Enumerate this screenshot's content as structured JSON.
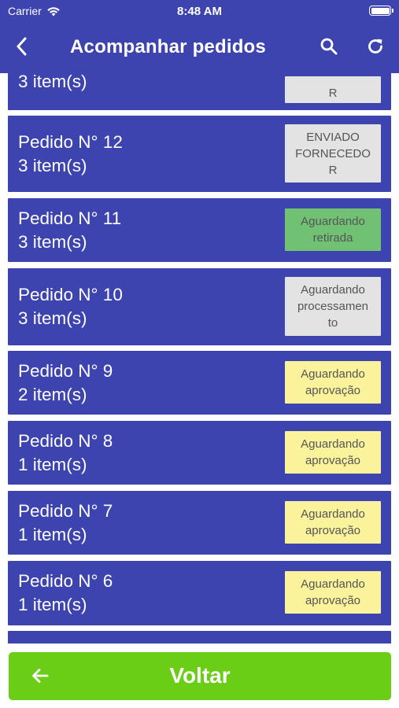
{
  "status_bar": {
    "carrier": "Carrier",
    "time": "8:48 AM",
    "icons": [
      "wifi-icon",
      "battery-icon"
    ]
  },
  "app_bar": {
    "title": "Acompanhar pedidos",
    "icons": [
      "back-chevron-icon",
      "search-icon",
      "refresh-icon"
    ]
  },
  "orders": [
    {
      "title": "",
      "items": "3 item(s)",
      "status": "R",
      "status_color": "#e3e3e3"
    },
    {
      "title": "Pedido N° 12",
      "items": "3 item(s)",
      "status": "ENVIADO FORNECEDO R",
      "status_lines": [
        "ENVIADO",
        "FORNECEDO",
        "R"
      ],
      "status_color": "#e3e3e3"
    },
    {
      "title": "Pedido N° 11",
      "items": "3 item(s)",
      "status": "Aguardando retirada",
      "status_lines": [
        "Aguardando",
        "retirada"
      ],
      "status_color": "#71c175"
    },
    {
      "title": "Pedido N° 10",
      "items": "3 item(s)",
      "status": "Aguardando processamento",
      "status_lines": [
        "Aguardando",
        "processamen",
        "to"
      ],
      "status_color": "#e3e3e3"
    },
    {
      "title": "Pedido N° 9",
      "items": "2 item(s)",
      "status": "Aguardando aprovação",
      "status_lines": [
        "Aguardando",
        "aprovação"
      ],
      "status_color": "#fbf39b"
    },
    {
      "title": "Pedido N° 8",
      "items": "1 item(s)",
      "status": "Aguardando aprovação",
      "status_lines": [
        "Aguardando",
        "aprovação"
      ],
      "status_color": "#fbf39b"
    },
    {
      "title": "Pedido N° 7",
      "items": "1 item(s)",
      "status": "Aguardando aprovação",
      "status_lines": [
        "Aguardando",
        "aprovação"
      ],
      "status_color": "#fbf39b"
    },
    {
      "title": "Pedido N° 6",
      "items": "1 item(s)",
      "status": "Aguardando aprovação",
      "status_lines": [
        "Aguardando",
        "aprovação"
      ],
      "status_color": "#fbf39b"
    }
  ],
  "footer": {
    "back_button_label": "Voltar",
    "back_icon": "arrow-left-icon"
  },
  "colors": {
    "primary": "#3d44b0",
    "button_green": "#6acd16",
    "badge_gray": "#e3e3e3",
    "badge_green": "#71c175",
    "badge_yellow": "#fbf39b"
  }
}
